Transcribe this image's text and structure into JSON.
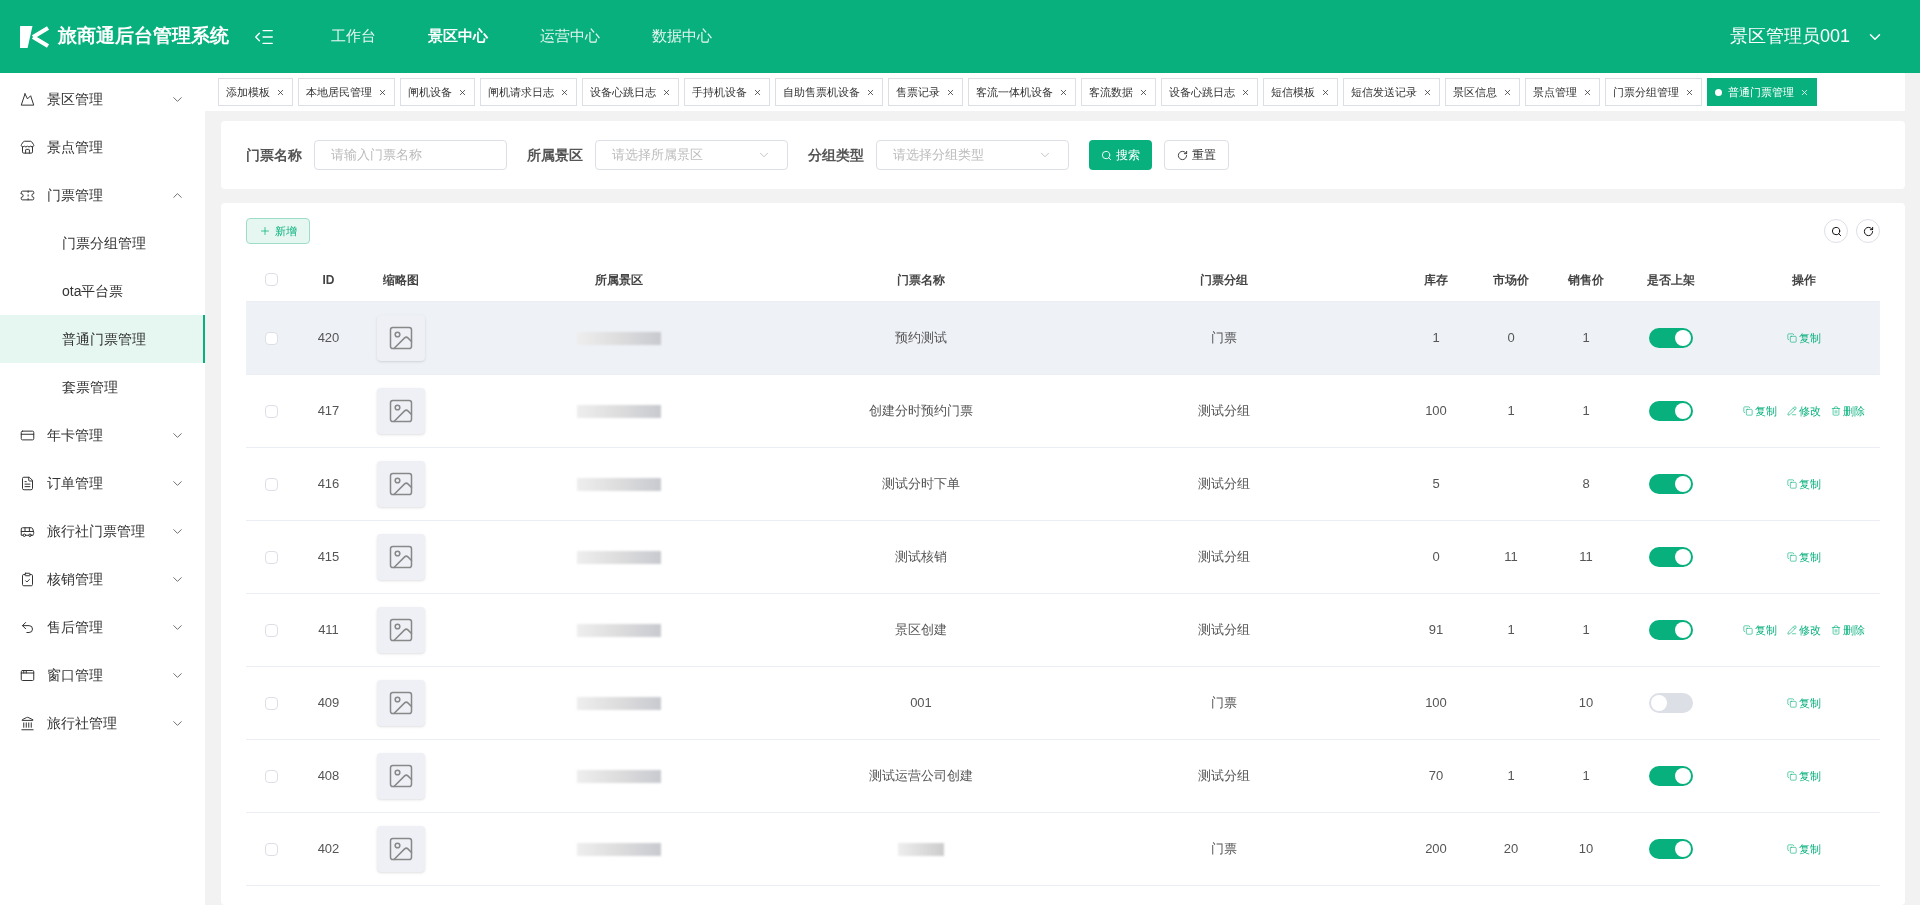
{
  "header": {
    "logo": "旅商通后台管理系统",
    "nav": [
      {
        "label": "工作台",
        "selected": false
      },
      {
        "label": "景区中心",
        "selected": true
      },
      {
        "label": "运营中心",
        "selected": false
      },
      {
        "label": "数据中心",
        "selected": false
      }
    ],
    "user": "景区管理员001"
  },
  "sidebar": {
    "items": [
      {
        "label": "景区管理",
        "expanded": false
      },
      {
        "label": "景点管理"
      },
      {
        "label": "门票管理",
        "expanded": true,
        "children": [
          {
            "label": "门票分组管理",
            "selected": false
          },
          {
            "label": "ota平台票",
            "selected": false
          },
          {
            "label": "普通门票管理",
            "selected": true
          },
          {
            "label": "套票管理",
            "selected": false
          }
        ]
      },
      {
        "label": "年卡管理",
        "expanded": false
      },
      {
        "label": "订单管理",
        "expanded": false
      },
      {
        "label": "旅行社门票管理",
        "expanded": false
      },
      {
        "label": "核销管理",
        "expanded": false
      },
      {
        "label": "售后管理",
        "expanded": false
      },
      {
        "label": "窗口管理",
        "expanded": false
      },
      {
        "label": "旅行社管理",
        "expanded": false
      }
    ]
  },
  "tabs": [
    {
      "label": "添加模板",
      "selected": false
    },
    {
      "label": "本地居民管理",
      "selected": false
    },
    {
      "label": "闸机设备",
      "selected": false
    },
    {
      "label": "闸机请求日志",
      "selected": false
    },
    {
      "label": "设备心跳日志",
      "selected": false
    },
    {
      "label": "手持机设备",
      "selected": false
    },
    {
      "label": "自助售票机设备",
      "selected": false
    },
    {
      "label": "售票记录",
      "selected": false
    },
    {
      "label": "客流一体机设备",
      "selected": false
    },
    {
      "label": "客流数据",
      "selected": false
    },
    {
      "label": "设备心跳日志",
      "selected": false
    },
    {
      "label": "短信模板",
      "selected": false
    },
    {
      "label": "短信发送记录",
      "selected": false
    },
    {
      "label": "景区信息",
      "selected": false
    },
    {
      "label": "景点管理",
      "selected": false
    },
    {
      "label": "门票分组管理",
      "selected": false
    },
    {
      "label": "普通门票管理",
      "selected": true
    }
  ],
  "search": {
    "fields": [
      {
        "label": "门票名称",
        "placeholder": "请输入门票名称",
        "kind": "input"
      },
      {
        "label": "所属景区",
        "placeholder": "请选择所属景区",
        "kind": "select"
      },
      {
        "label": "分组类型",
        "placeholder": "请选择分组类型",
        "kind": "select"
      }
    ],
    "search_button": "搜索",
    "reset_button": "重置"
  },
  "table": {
    "add_button": "新增",
    "all_checked": false,
    "columns": [
      "ID",
      "缩略图",
      "所属景区",
      "门票名称",
      "门票分组",
      "库存",
      "市场价",
      "销售价",
      "是否上架",
      "操作"
    ],
    "rows": [
      {
        "id": "420",
        "name": "预约测试",
        "group": "门票",
        "stock": "1",
        "market_price": "0",
        "sale_price": "1",
        "on_sale": true,
        "highlighted": true,
        "checked": false,
        "actions": [
          {
            "kind": "copy",
            "label": "复制"
          }
        ]
      },
      {
        "id": "417",
        "name": "创建分时预约门票",
        "group": "测试分组",
        "stock": "100",
        "market_price": "1",
        "sale_price": "1",
        "on_sale": true,
        "highlighted": false,
        "checked": false,
        "actions": [
          {
            "kind": "copy",
            "label": "复制"
          },
          {
            "kind": "edit",
            "label": "修改"
          },
          {
            "kind": "delete",
            "label": "删除"
          }
        ]
      },
      {
        "id": "416",
        "name": "测试分时下单",
        "group": "测试分组",
        "stock": "5",
        "sale_price": "8",
        "on_sale": true,
        "highlighted": false,
        "checked": false,
        "actions": [
          {
            "kind": "copy",
            "label": "复制"
          }
        ]
      },
      {
        "id": "415",
        "name": "测试核销",
        "group": "测试分组",
        "stock": "0",
        "market_price": "11",
        "sale_price": "11",
        "on_sale": true,
        "highlighted": false,
        "checked": false,
        "actions": [
          {
            "kind": "copy",
            "label": "复制"
          }
        ]
      },
      {
        "id": "411",
        "name": "景区创建",
        "group": "测试分组",
        "stock": "91",
        "market_price": "1",
        "sale_price": "1",
        "on_sale": true,
        "highlighted": false,
        "checked": false,
        "actions": [
          {
            "kind": "copy",
            "label": "复制"
          },
          {
            "kind": "edit",
            "label": "修改"
          },
          {
            "kind": "delete",
            "label": "删除"
          }
        ]
      },
      {
        "id": "409",
        "name": "001",
        "group": "门票",
        "stock": "100",
        "sale_price": "10",
        "on_sale": false,
        "highlighted": false,
        "checked": false,
        "actions": [
          {
            "kind": "copy",
            "label": "复制"
          }
        ]
      },
      {
        "id": "408",
        "name": "测试运营公司创建",
        "group": "测试分组",
        "stock": "70",
        "market_price": "1",
        "sale_price": "1",
        "on_sale": true,
        "highlighted": false,
        "checked": false,
        "actions": [
          {
            "kind": "copy",
            "label": "复制"
          }
        ]
      },
      {
        "id": "402",
        "group": "门票",
        "stock": "200",
        "market_price": "20",
        "sale_price": "10",
        "on_sale": true,
        "highlighted": false,
        "checked": false,
        "actions": [
          {
            "kind": "copy",
            "label": "复制"
          }
        ]
      }
    ]
  }
}
